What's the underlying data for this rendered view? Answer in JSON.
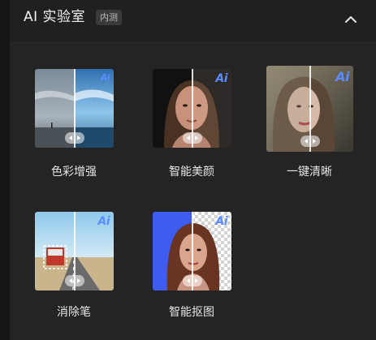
{
  "header": {
    "title": "AI 实验室",
    "badge": "内测",
    "collapse_icon": "chevron-up-icon"
  },
  "tools": [
    {
      "label": "色彩增强",
      "icon": "color-enhance-thumbnail"
    },
    {
      "label": "智能美颜",
      "icon": "beauty-thumbnail"
    },
    {
      "label": "一键清晰",
      "icon": "sharpen-thumbnail"
    },
    {
      "label": "消除笔",
      "icon": "eraser-thumbnail"
    },
    {
      "label": "智能抠图",
      "icon": "cutout-thumbnail"
    }
  ],
  "ai_mark": "Ai",
  "colors": {
    "accent": "#5a8cff",
    "panel": "#242424",
    "header": "#202020"
  }
}
